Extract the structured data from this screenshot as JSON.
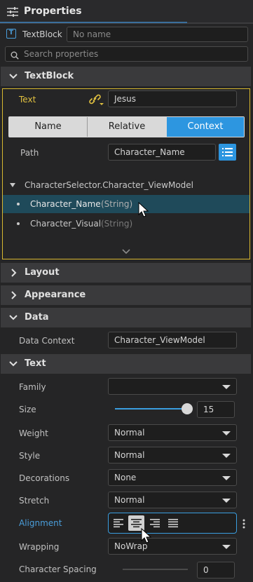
{
  "panel": {
    "title": "Properties",
    "icon": "sliders-icon"
  },
  "object": {
    "type_label": "TextBlock",
    "name_placeholder": "No name",
    "name_value": ""
  },
  "search": {
    "placeholder": "Search properties"
  },
  "sections": {
    "textblock": "TextBlock",
    "layout": "Layout",
    "appearance": "Appearance",
    "data": "Data",
    "text": "Text"
  },
  "binding": {
    "text_label": "Text",
    "text_value": "Jesus",
    "modes": [
      "Name",
      "Relative",
      "Context"
    ],
    "selected_mode": "Context",
    "path_label": "Path",
    "path_value": "Character_Name",
    "tree_root": "CharacterSelector.Character_ViewModel",
    "tree_items": [
      {
        "name": "Character_Name",
        "type": "(String)",
        "selected": true
      },
      {
        "name": "Character_Visual",
        "type": "(String)",
        "selected": false
      }
    ]
  },
  "data_section": {
    "context_label": "Data Context",
    "context_value": "Character_ViewModel"
  },
  "text_section": {
    "family_label": "Family",
    "family_value": "",
    "size_label": "Size",
    "size_value": "15",
    "weight_label": "Weight",
    "weight_value": "Normal",
    "style_label": "Style",
    "style_value": "Normal",
    "decorations_label": "Decorations",
    "decorations_value": "None",
    "stretch_label": "Stretch",
    "stretch_value": "Normal",
    "alignment_label": "Alignment",
    "alignment_selected": "center",
    "wrapping_label": "Wrapping",
    "wrapping_value": "NoWrap",
    "spacing_label": "Character Spacing",
    "spacing_value": "0"
  },
  "colors": {
    "accent": "#3a9ee0",
    "binding_highlight": "#e0c040",
    "selected_row": "#1f4a5a",
    "panel_bg": "#252526"
  }
}
